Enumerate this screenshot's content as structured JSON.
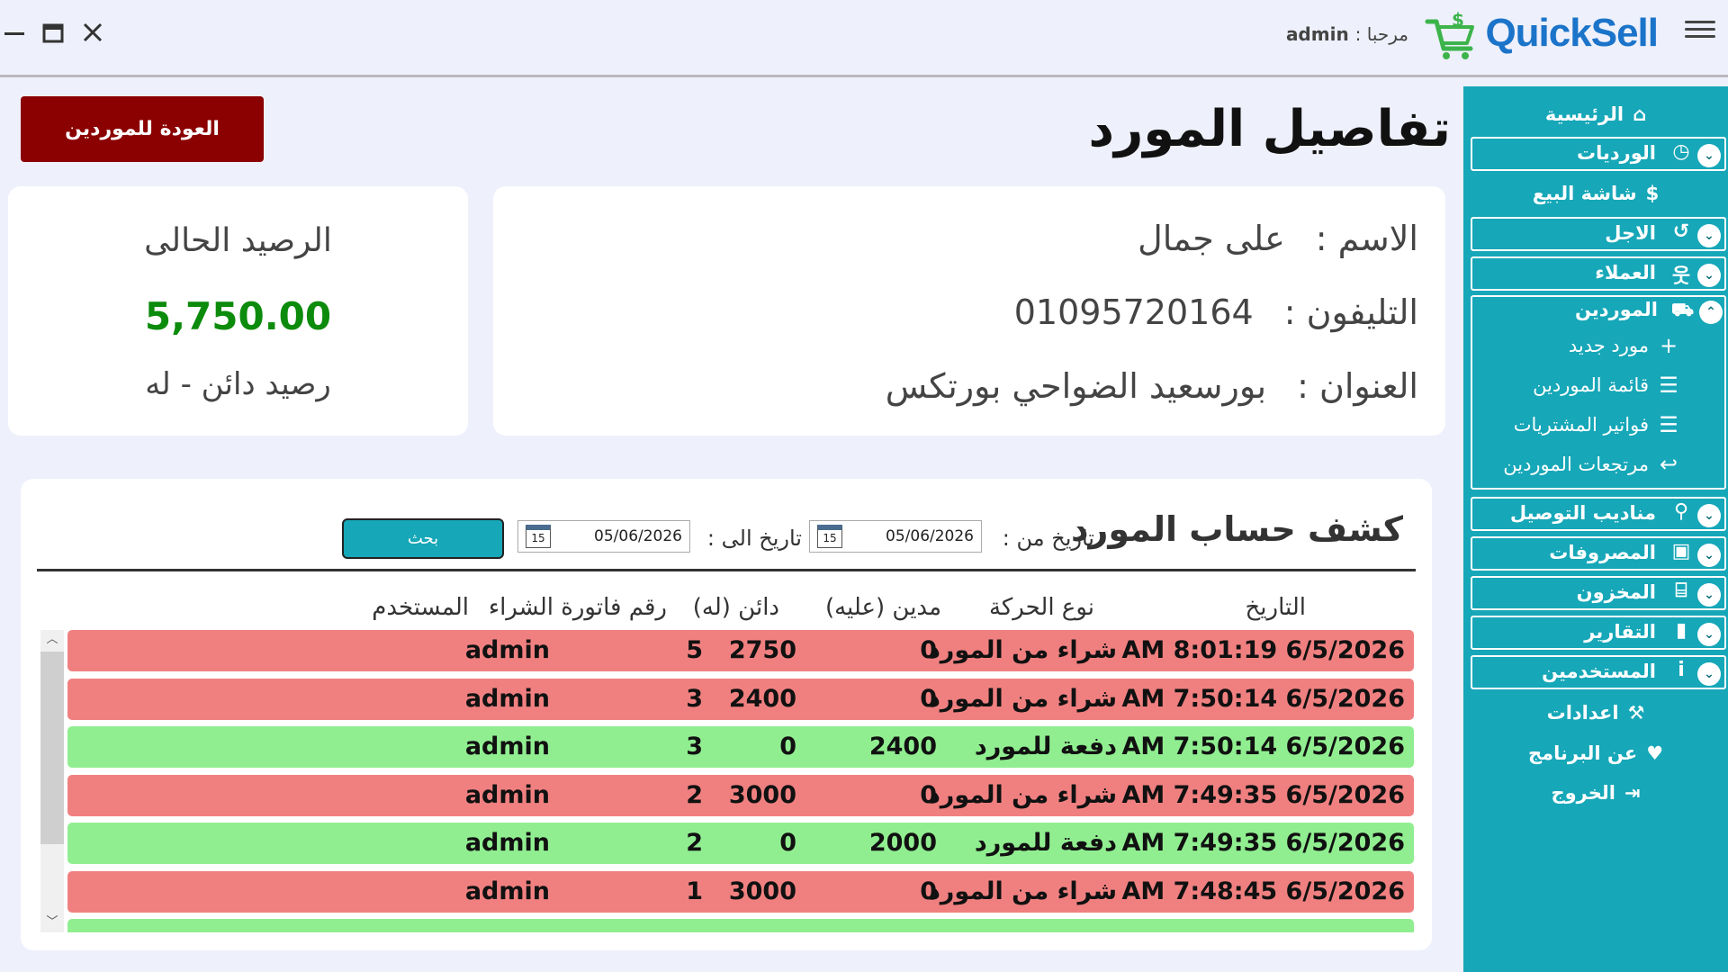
{
  "titlebar": {
    "app_name": "QuickSell",
    "welcome_label": "مرحبا :",
    "username": "admin"
  },
  "sidebar": {
    "home": "الرئيسية",
    "shifts": "الورديات",
    "pos": "شاشة البيع",
    "credit": "الاجل",
    "customers": "العملاء",
    "suppliers": "الموردين",
    "suppliers_sub": {
      "new_supplier": "مورد جديد",
      "supplier_list": "قائمة الموردين",
      "purchase_invoices": "فواتير المشتريات",
      "supplier_returns": "مرتجعات الموردين"
    },
    "delivery": "مناديب التوصيل",
    "expenses": "المصروفات",
    "inventory": "المخزون",
    "reports": "التقارير",
    "users": "المستخدمين",
    "settings": "اعدادات",
    "about": "عن البرنامج",
    "logout": "الخروج"
  },
  "page": {
    "title": "تفاصيل المورد",
    "back_button": "العودة للموردين"
  },
  "supplier": {
    "name_label": "الاسم :",
    "name": "على جمال",
    "phone_label": "التليفون :",
    "phone": "01095720164",
    "address_label": "العنوان :",
    "address": "بورسعيد الضواحي بورتكس"
  },
  "balance": {
    "title": "الرصيد الحالى",
    "value": "5,750.00",
    "status": "رصيد دائن - له"
  },
  "statement": {
    "title": "كشف حساب المورد",
    "from_label": "تاريخ من :",
    "from_date": "05/06/2026",
    "to_label": "تاريخ الى :",
    "to_date": "05/06/2026",
    "calendar_day": "15",
    "search_button": "بحث",
    "columns": {
      "date": "التاريخ",
      "type": "نوع الحركة",
      "debit": "مدين (عليه)",
      "credit": "دائن (له)",
      "invoice": "رقم فاتورة الشراء",
      "user": "المستخدم"
    },
    "rows": [
      {
        "date": "6/5/2026 8:01:19 AM",
        "type": "شراء من المورد",
        "debit": "0",
        "credit": "2750",
        "invoice": "5",
        "user": "admin",
        "kind": "purchase"
      },
      {
        "date": "6/5/2026 7:50:14 AM",
        "type": "شراء من المورد",
        "debit": "0",
        "credit": "2400",
        "invoice": "3",
        "user": "admin",
        "kind": "purchase"
      },
      {
        "date": "6/5/2026 7:50:14 AM",
        "type": "دفعة للمورد",
        "debit": "2400",
        "credit": "0",
        "invoice": "3",
        "user": "admin",
        "kind": "payment"
      },
      {
        "date": "6/5/2026 7:49:35 AM",
        "type": "شراء من المورد",
        "debit": "0",
        "credit": "3000",
        "invoice": "2",
        "user": "admin",
        "kind": "purchase"
      },
      {
        "date": "6/5/2026 7:49:35 AM",
        "type": "دفعة للمورد",
        "debit": "2000",
        "credit": "0",
        "invoice": "2",
        "user": "admin",
        "kind": "payment"
      },
      {
        "date": "6/5/2026 7:48:45 AM",
        "type": "شراء من المورد",
        "debit": "0",
        "credit": "3000",
        "invoice": "1",
        "user": "admin",
        "kind": "purchase"
      }
    ]
  },
  "colors": {
    "sidebar": "#16a7b8",
    "purchase_row": "#f08080",
    "payment_row": "#90ee90",
    "back_button": "#8b0000",
    "balance_value": "#0c8b0c"
  }
}
